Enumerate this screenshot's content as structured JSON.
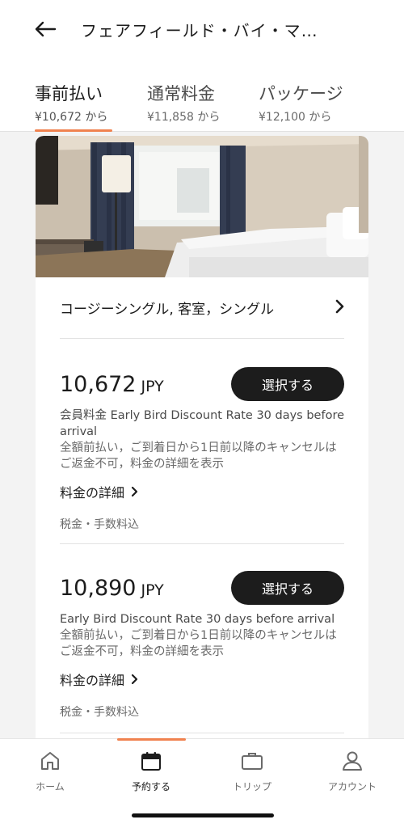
{
  "header": {
    "title": "フェアフィールド・バイ・マ…"
  },
  "tabs": [
    {
      "label": "事前払い",
      "price": "¥10,672 から",
      "active": true
    },
    {
      "label": "通常料金",
      "price": "¥11,858 から",
      "active": false
    },
    {
      "label": "パッケージ",
      "price": "¥12,100 から",
      "active": false
    }
  ],
  "room": {
    "name": "コージーシングル, 客室，シングル"
  },
  "rates": [
    {
      "amount": "10,672",
      "currency": "JPY",
      "select_label": "選択する",
      "name": "会員料金 Early Bird Discount Rate 30 days before arrival",
      "policy": "全額前払い，ご到着日から1日前以降のキャンセルはご返金不可，料金の詳細を表示",
      "details_label": "料金の詳細",
      "tax_note": "税金・手数料込"
    },
    {
      "amount": "10,890",
      "currency": "JPY",
      "select_label": "選択する",
      "name": "Early Bird Discount Rate 30 days before arrival",
      "policy": "全額前払い，ご到着日から1日前以降のキャンセルはご返金不可，料金の詳細を表示",
      "details_label": "料金の詳細",
      "tax_note": "税金・手数料込"
    }
  ],
  "bottom_nav": [
    {
      "label": "ホーム",
      "icon": "home-icon",
      "active": false
    },
    {
      "label": "予約する",
      "icon": "calendar-icon",
      "active": true
    },
    {
      "label": "トリップ",
      "icon": "briefcase-icon",
      "active": false
    },
    {
      "label": "アカウント",
      "icon": "account-icon",
      "active": false
    }
  ],
  "colors": {
    "accent": "#f0824f",
    "button": "#1c1c1c"
  }
}
